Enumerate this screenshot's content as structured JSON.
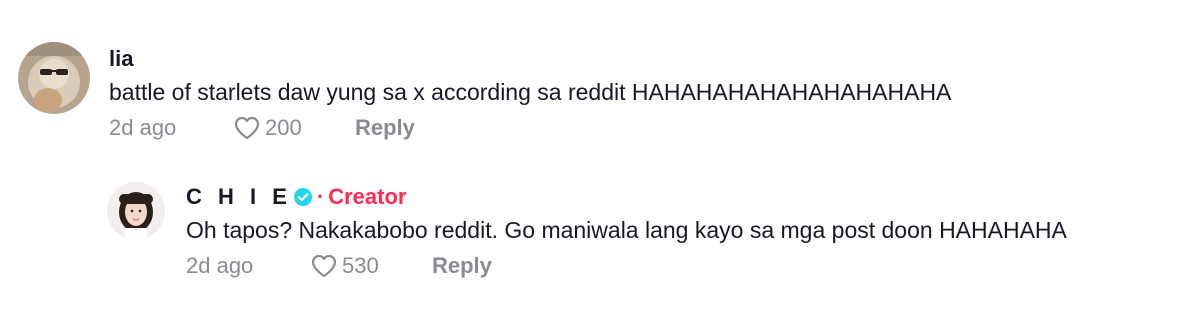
{
  "comments": [
    {
      "username": "lia",
      "text": "battle of starlets daw yung sa x according sa reddit HAHAHAHAHAHAHAHAHAHA",
      "time": "2d ago",
      "likes": "200",
      "reply_label": "Reply",
      "avatar_icon": "user-avatar-icon"
    },
    {
      "username": "C H I E",
      "verified_icon": "verified-badge-icon",
      "separator": "·",
      "badge": "Creator",
      "text": "Oh tapos? Nakakabobo reddit. Go maniwala lang kayo sa mga post doon HAHAHAHA",
      "time": "2d ago",
      "likes": "530",
      "reply_label": "Reply",
      "avatar_icon": "user-avatar-icon"
    }
  ],
  "colors": {
    "text": "#161823",
    "muted": "#8a8b91",
    "creator": "#fe2c55",
    "verified": "#20d5ec"
  }
}
